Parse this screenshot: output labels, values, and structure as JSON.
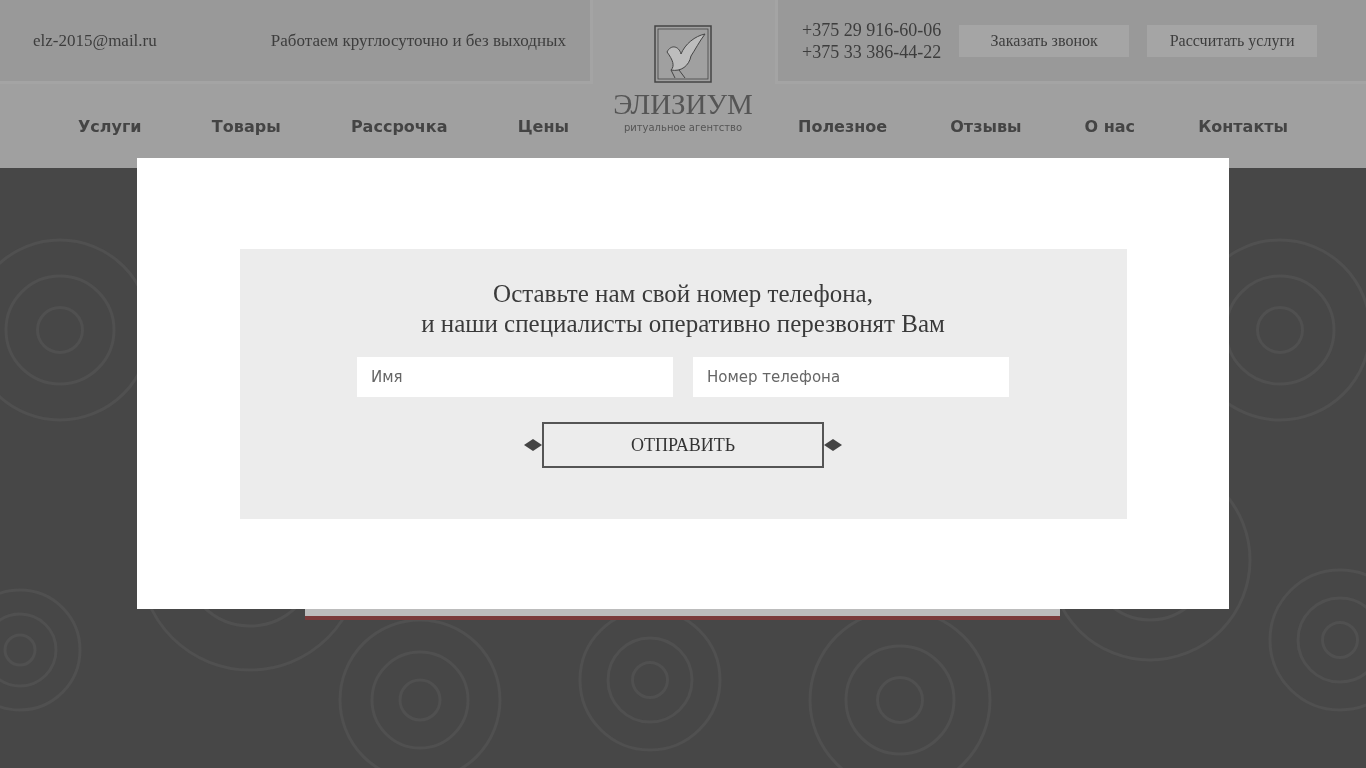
{
  "header": {
    "email": "elz-2015@mail.ru",
    "hours": "Работаем круглосуточно и без выходных",
    "phones": [
      "+375 29 916-60-06",
      "+375 33 386-44-22"
    ],
    "buttons": [
      "Заказать звонок",
      "Рассчитать услуги"
    ],
    "logo": {
      "name": "ЭЛИЗИУМ",
      "tagline": "ритуальное агентство"
    }
  },
  "nav_left": [
    "Услуги",
    "Товары",
    "Рассрочка",
    "Цены"
  ],
  "nav_right": [
    "Полезное",
    "Отзывы",
    "О нас",
    "Контакты"
  ],
  "modal": {
    "title_lines": [
      "Оставьте нам свой номер телефона,",
      "и наши специалисты оперативно перезвонят Вам"
    ],
    "fields": [
      {
        "placeholder": "Имя"
      },
      {
        "placeholder": "Номер телефона"
      }
    ],
    "submit": "ОТПРАВИТЬ"
  }
}
